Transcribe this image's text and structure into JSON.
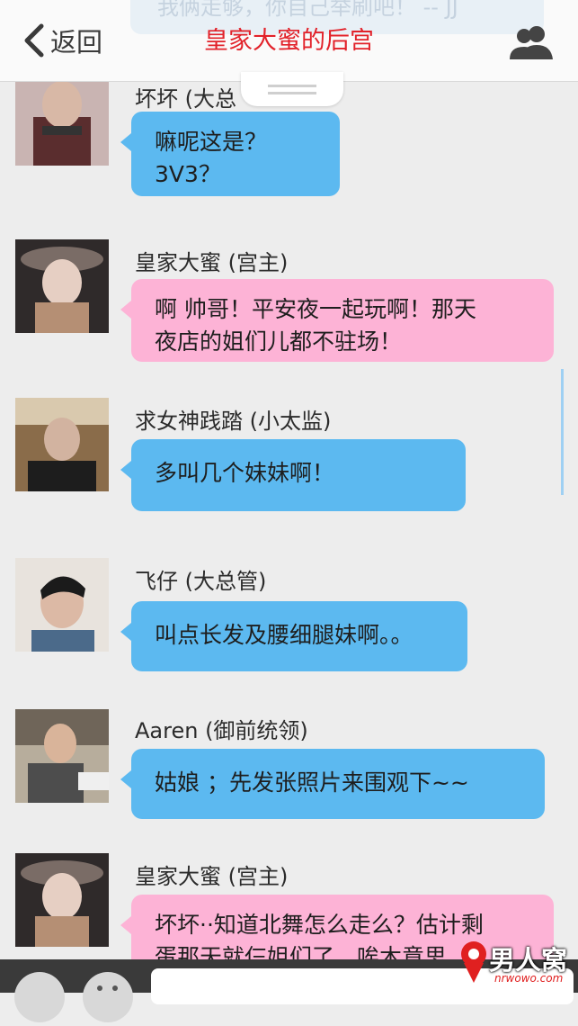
{
  "header": {
    "back_label": "返回",
    "title": "皇家大蜜的后宫",
    "ghost_text": "我俩走够，你自己举刷吧！ -- JJ",
    "back_icon": "chevron-left-icon",
    "members_icon": "group-icon"
  },
  "messages": [
    {
      "sender": "坏坏 (大总",
      "text": "嘛呢这是？\n3V3？",
      "color": "blue"
    },
    {
      "sender": "皇家大蜜 (宫主)",
      "text": "啊 帅哥！平安夜一起玩啊！那天\n夜店的姐们儿都不驻场！",
      "color": "pink"
    },
    {
      "sender": "求女神践踏 (小太监)",
      "text": "多叫几个妹妹啊！",
      "color": "blue"
    },
    {
      "sender": "飞仔 (大总管)",
      "text": "叫点长发及腰细腿妹啊。。",
      "color": "blue"
    },
    {
      "sender": "Aaren (御前统领)",
      "text": "姑娘  ；先发张照片来围观下~~",
      "color": "blue"
    },
    {
      "sender": "皇家大蜜 (宫主)",
      "text": "坏坏··知道北舞怎么走么？估计剩\n蛋那天就仨姐们了，唉木意思",
      "color": "pink"
    }
  ],
  "bottom": {
    "voice_icon": "voice-icon",
    "emoji_icon": "emoji-icon"
  },
  "watermark": {
    "text": "男人窝",
    "sub": "nrwowo.com"
  },
  "colors": {
    "title": "#e2222a",
    "blue_bubble": "#5cb9f0",
    "pink_bubble": "#fdb3d6",
    "background": "#ededed"
  }
}
